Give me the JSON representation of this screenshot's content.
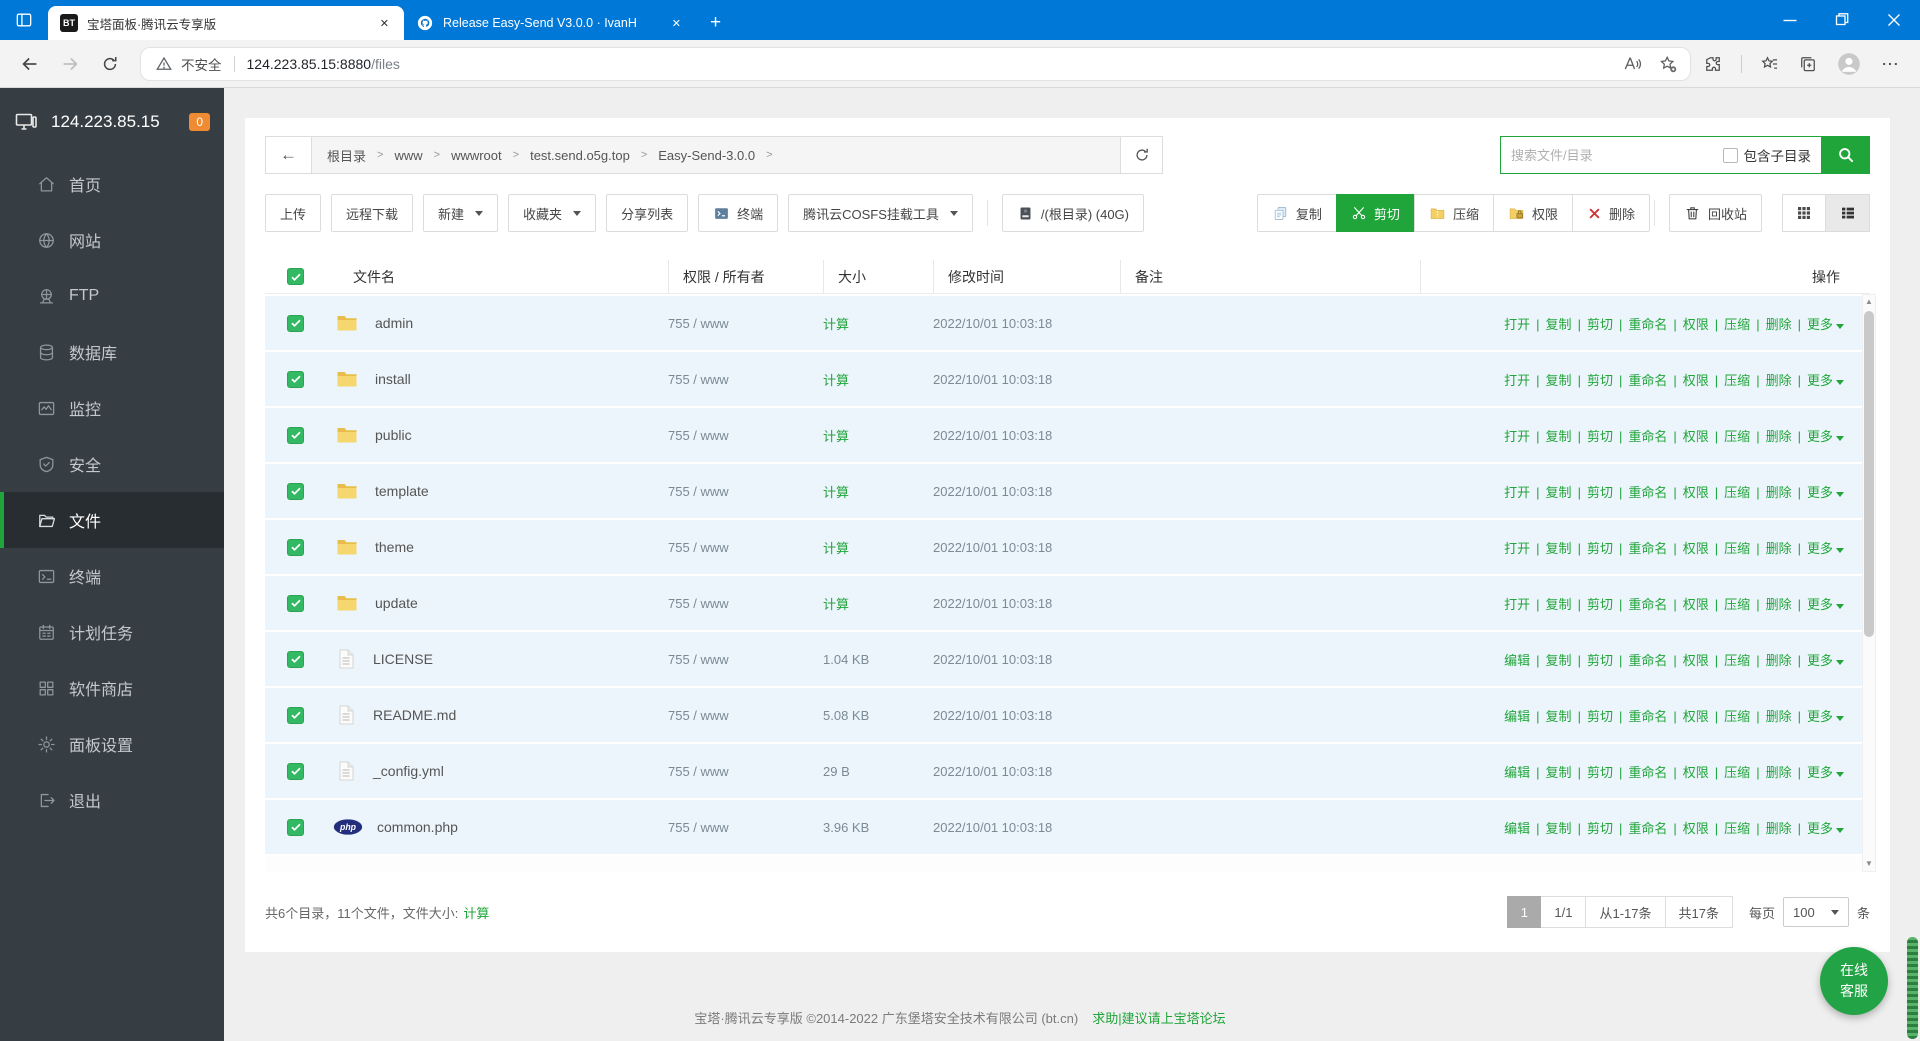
{
  "browser": {
    "tabs": [
      {
        "title": "宝塔面板·腾讯云专享版",
        "favicon": "BT",
        "active": true
      },
      {
        "title": "Release Easy-Send V3.0.0 · IvanH",
        "favicon": "github",
        "active": false
      }
    ],
    "new_tab_label": "+",
    "address": {
      "security": "不安全",
      "host": "124.223.85.15:8880",
      "path": "/files"
    },
    "toolbar_icons": [
      "read-aloud",
      "favorite-add",
      "extensions",
      "favorites",
      "collections",
      "profile",
      "more"
    ]
  },
  "sidebar": {
    "server": "124.223.85.15",
    "badge": "0",
    "items": [
      {
        "label": "首页",
        "icon": "home",
        "active": false
      },
      {
        "label": "网站",
        "icon": "site",
        "active": false
      },
      {
        "label": "FTP",
        "icon": "ftp",
        "active": false
      },
      {
        "label": "数据库",
        "icon": "database",
        "active": false
      },
      {
        "label": "监控",
        "icon": "monitor",
        "active": false
      },
      {
        "label": "安全",
        "icon": "security",
        "active": false
      },
      {
        "label": "文件",
        "icon": "files",
        "active": true
      },
      {
        "label": "终端",
        "icon": "terminal",
        "active": false
      },
      {
        "label": "计划任务",
        "icon": "cron",
        "active": false
      },
      {
        "label": "软件商店",
        "icon": "soft",
        "active": false
      },
      {
        "label": "面板设置",
        "icon": "config",
        "active": false
      },
      {
        "label": "退出",
        "icon": "logout",
        "active": false
      }
    ]
  },
  "breadcrumb": {
    "items": [
      "根目录",
      "www",
      "wwwroot",
      "test.send.o5g.top",
      "Easy-Send-3.0.0"
    ]
  },
  "search": {
    "placeholder": "搜索文件/目录",
    "include_subdir_label": "包含子目录"
  },
  "toolbar": {
    "left": [
      {
        "name": "upload",
        "label": "上传"
      },
      {
        "name": "remote-download",
        "label": "远程下载"
      },
      {
        "name": "new",
        "label": "新建",
        "caret": true
      },
      {
        "name": "favorites",
        "label": "收藏夹",
        "caret": true
      },
      {
        "name": "share-list",
        "label": "分享列表"
      },
      {
        "name": "terminal",
        "label": "终端",
        "icon": "term"
      },
      {
        "name": "cosfs-tool",
        "label": "腾讯云COSFS挂载工具",
        "caret": true
      }
    ],
    "disk": {
      "name": "root-disk",
      "label": "/(根目录) (40G)",
      "icon": "disk"
    },
    "right": [
      {
        "name": "copy",
        "label": "复制",
        "icon": "copy"
      },
      {
        "name": "cut",
        "label": "剪切",
        "icon": "cut",
        "active": true
      },
      {
        "name": "compress",
        "label": "压缩",
        "icon": "zip"
      },
      {
        "name": "permission",
        "label": "权限",
        "icon": "perm"
      },
      {
        "name": "delete",
        "label": "删除",
        "icon": "del"
      }
    ],
    "recycle": {
      "name": "recycle-bin",
      "label": "回收站",
      "icon": "trash"
    }
  },
  "table": {
    "headers": [
      "文件名",
      "权限 / 所有者",
      "大小",
      "修改时间",
      "备注",
      "操作"
    ],
    "rows": [
      {
        "name": "admin",
        "icon": "folder",
        "checked": true,
        "perm": "755 / www",
        "size": "计算",
        "size_is_link": true,
        "mtime": "2022/10/01 10:03:18",
        "note": "",
        "actions": [
          "打开",
          "复制",
          "剪切",
          "重命名",
          "权限",
          "压缩",
          "删除",
          "更多"
        ]
      },
      {
        "name": "install",
        "icon": "folder",
        "checked": true,
        "perm": "755 / www",
        "size": "计算",
        "size_is_link": true,
        "mtime": "2022/10/01 10:03:18",
        "note": "",
        "actions": [
          "打开",
          "复制",
          "剪切",
          "重命名",
          "权限",
          "压缩",
          "删除",
          "更多"
        ]
      },
      {
        "name": "public",
        "icon": "folder",
        "checked": true,
        "perm": "755 / www",
        "size": "计算",
        "size_is_link": true,
        "mtime": "2022/10/01 10:03:18",
        "note": "",
        "actions": [
          "打开",
          "复制",
          "剪切",
          "重命名",
          "权限",
          "压缩",
          "删除",
          "更多"
        ]
      },
      {
        "name": "template",
        "icon": "folder",
        "checked": true,
        "perm": "755 / www",
        "size": "计算",
        "size_is_link": true,
        "mtime": "2022/10/01 10:03:18",
        "note": "",
        "actions": [
          "打开",
          "复制",
          "剪切",
          "重命名",
          "权限",
          "压缩",
          "删除",
          "更多"
        ]
      },
      {
        "name": "theme",
        "icon": "folder",
        "checked": true,
        "perm": "755 / www",
        "size": "计算",
        "size_is_link": true,
        "mtime": "2022/10/01 10:03:18",
        "note": "",
        "actions": [
          "打开",
          "复制",
          "剪切",
          "重命名",
          "权限",
          "压缩",
          "删除",
          "更多"
        ]
      },
      {
        "name": "update",
        "icon": "folder",
        "checked": true,
        "perm": "755 / www",
        "size": "计算",
        "size_is_link": true,
        "mtime": "2022/10/01 10:03:18",
        "note": "",
        "actions": [
          "打开",
          "复制",
          "剪切",
          "重命名",
          "权限",
          "压缩",
          "删除",
          "更多"
        ]
      },
      {
        "name": "LICENSE",
        "icon": "file",
        "checked": true,
        "perm": "755 / www",
        "size": "1.04 KB",
        "size_is_link": false,
        "mtime": "2022/10/01 10:03:18",
        "note": "",
        "actions": [
          "编辑",
          "复制",
          "剪切",
          "重命名",
          "权限",
          "压缩",
          "删除",
          "更多"
        ]
      },
      {
        "name": "README.md",
        "icon": "file",
        "checked": true,
        "perm": "755 / www",
        "size": "5.08 KB",
        "size_is_link": false,
        "mtime": "2022/10/01 10:03:18",
        "note": "",
        "actions": [
          "编辑",
          "复制",
          "剪切",
          "重命名",
          "权限",
          "压缩",
          "删除",
          "更多"
        ]
      },
      {
        "name": "_config.yml",
        "icon": "file",
        "checked": true,
        "perm": "755 / www",
        "size": "29 B",
        "size_is_link": false,
        "mtime": "2022/10/01 10:03:18",
        "note": "",
        "actions": [
          "编辑",
          "复制",
          "剪切",
          "重命名",
          "权限",
          "压缩",
          "删除",
          "更多"
        ]
      },
      {
        "name": "common.php",
        "icon": "php",
        "checked": true,
        "perm": "755 / www",
        "size": "3.96 KB",
        "size_is_link": false,
        "mtime": "2022/10/01 10:03:18",
        "note": "",
        "actions": [
          "编辑",
          "复制",
          "剪切",
          "重命名",
          "权限",
          "压缩",
          "删除",
          "更多"
        ]
      }
    ]
  },
  "status": {
    "text": "共6个目录，11个文件，文件大小:",
    "calc": "计算"
  },
  "pagination": {
    "page": "1",
    "page_info": "1/1",
    "range": "从1-17条",
    "total": "共17条",
    "per_prefix": "每页",
    "per_value": "100",
    "per_suffix": "条"
  },
  "footer": {
    "copyright": "宝塔·腾讯云专享版 ©2014-2022 广东堡塔安全技术有限公司 (bt.cn)",
    "help_link": "求助|建议请上宝塔论坛"
  },
  "service": {
    "line1": "在线",
    "line2": "客服"
  }
}
